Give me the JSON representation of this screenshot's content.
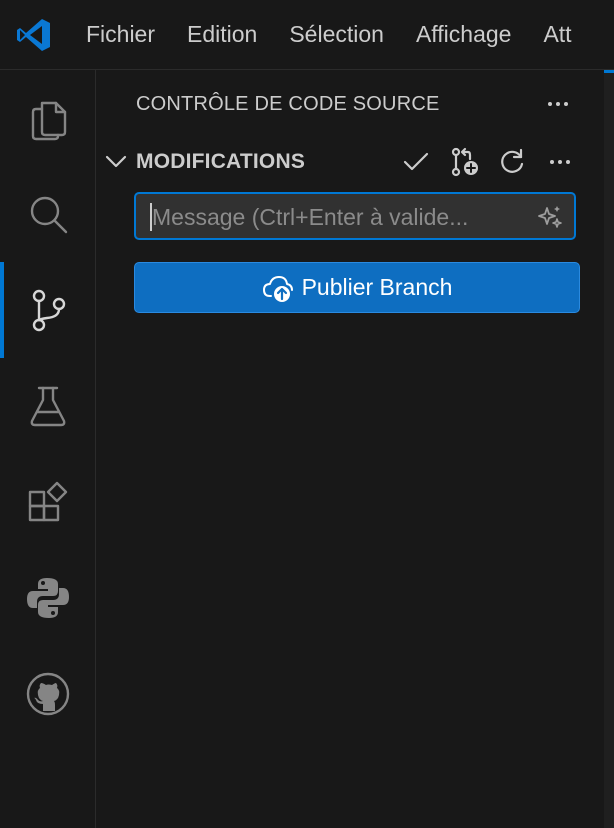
{
  "menu": {
    "items": [
      "Fichier",
      "Edition",
      "Sélection",
      "Affichage",
      "Att"
    ]
  },
  "activity_bar": {
    "items": [
      {
        "icon": "explorer-files-icon",
        "active": false
      },
      {
        "icon": "search-icon",
        "active": false
      },
      {
        "icon": "source-control-icon",
        "active": true
      },
      {
        "icon": "testing-flask-icon",
        "active": false
      },
      {
        "icon": "extensions-icon",
        "active": false
      },
      {
        "icon": "python-icon",
        "active": false
      },
      {
        "icon": "github-icon",
        "active": false
      }
    ]
  },
  "panel": {
    "title": "CONTRÔLE DE CODE SOURCE",
    "section": {
      "title": "MODIFICATIONS",
      "toolbar_icons": [
        "commit-check-icon",
        "stash-add-icon",
        "refresh-icon",
        "more-actions-icon"
      ]
    },
    "message_input": {
      "placeholder": "Message (Ctrl+Enter à valide..."
    },
    "publish_button": {
      "label": "Publier Branch",
      "icon": "cloud-upload-icon"
    }
  },
  "colors": {
    "background": "#181818",
    "accent": "#0078d4",
    "button": "#0e6ec1",
    "text": "#cccccc"
  }
}
